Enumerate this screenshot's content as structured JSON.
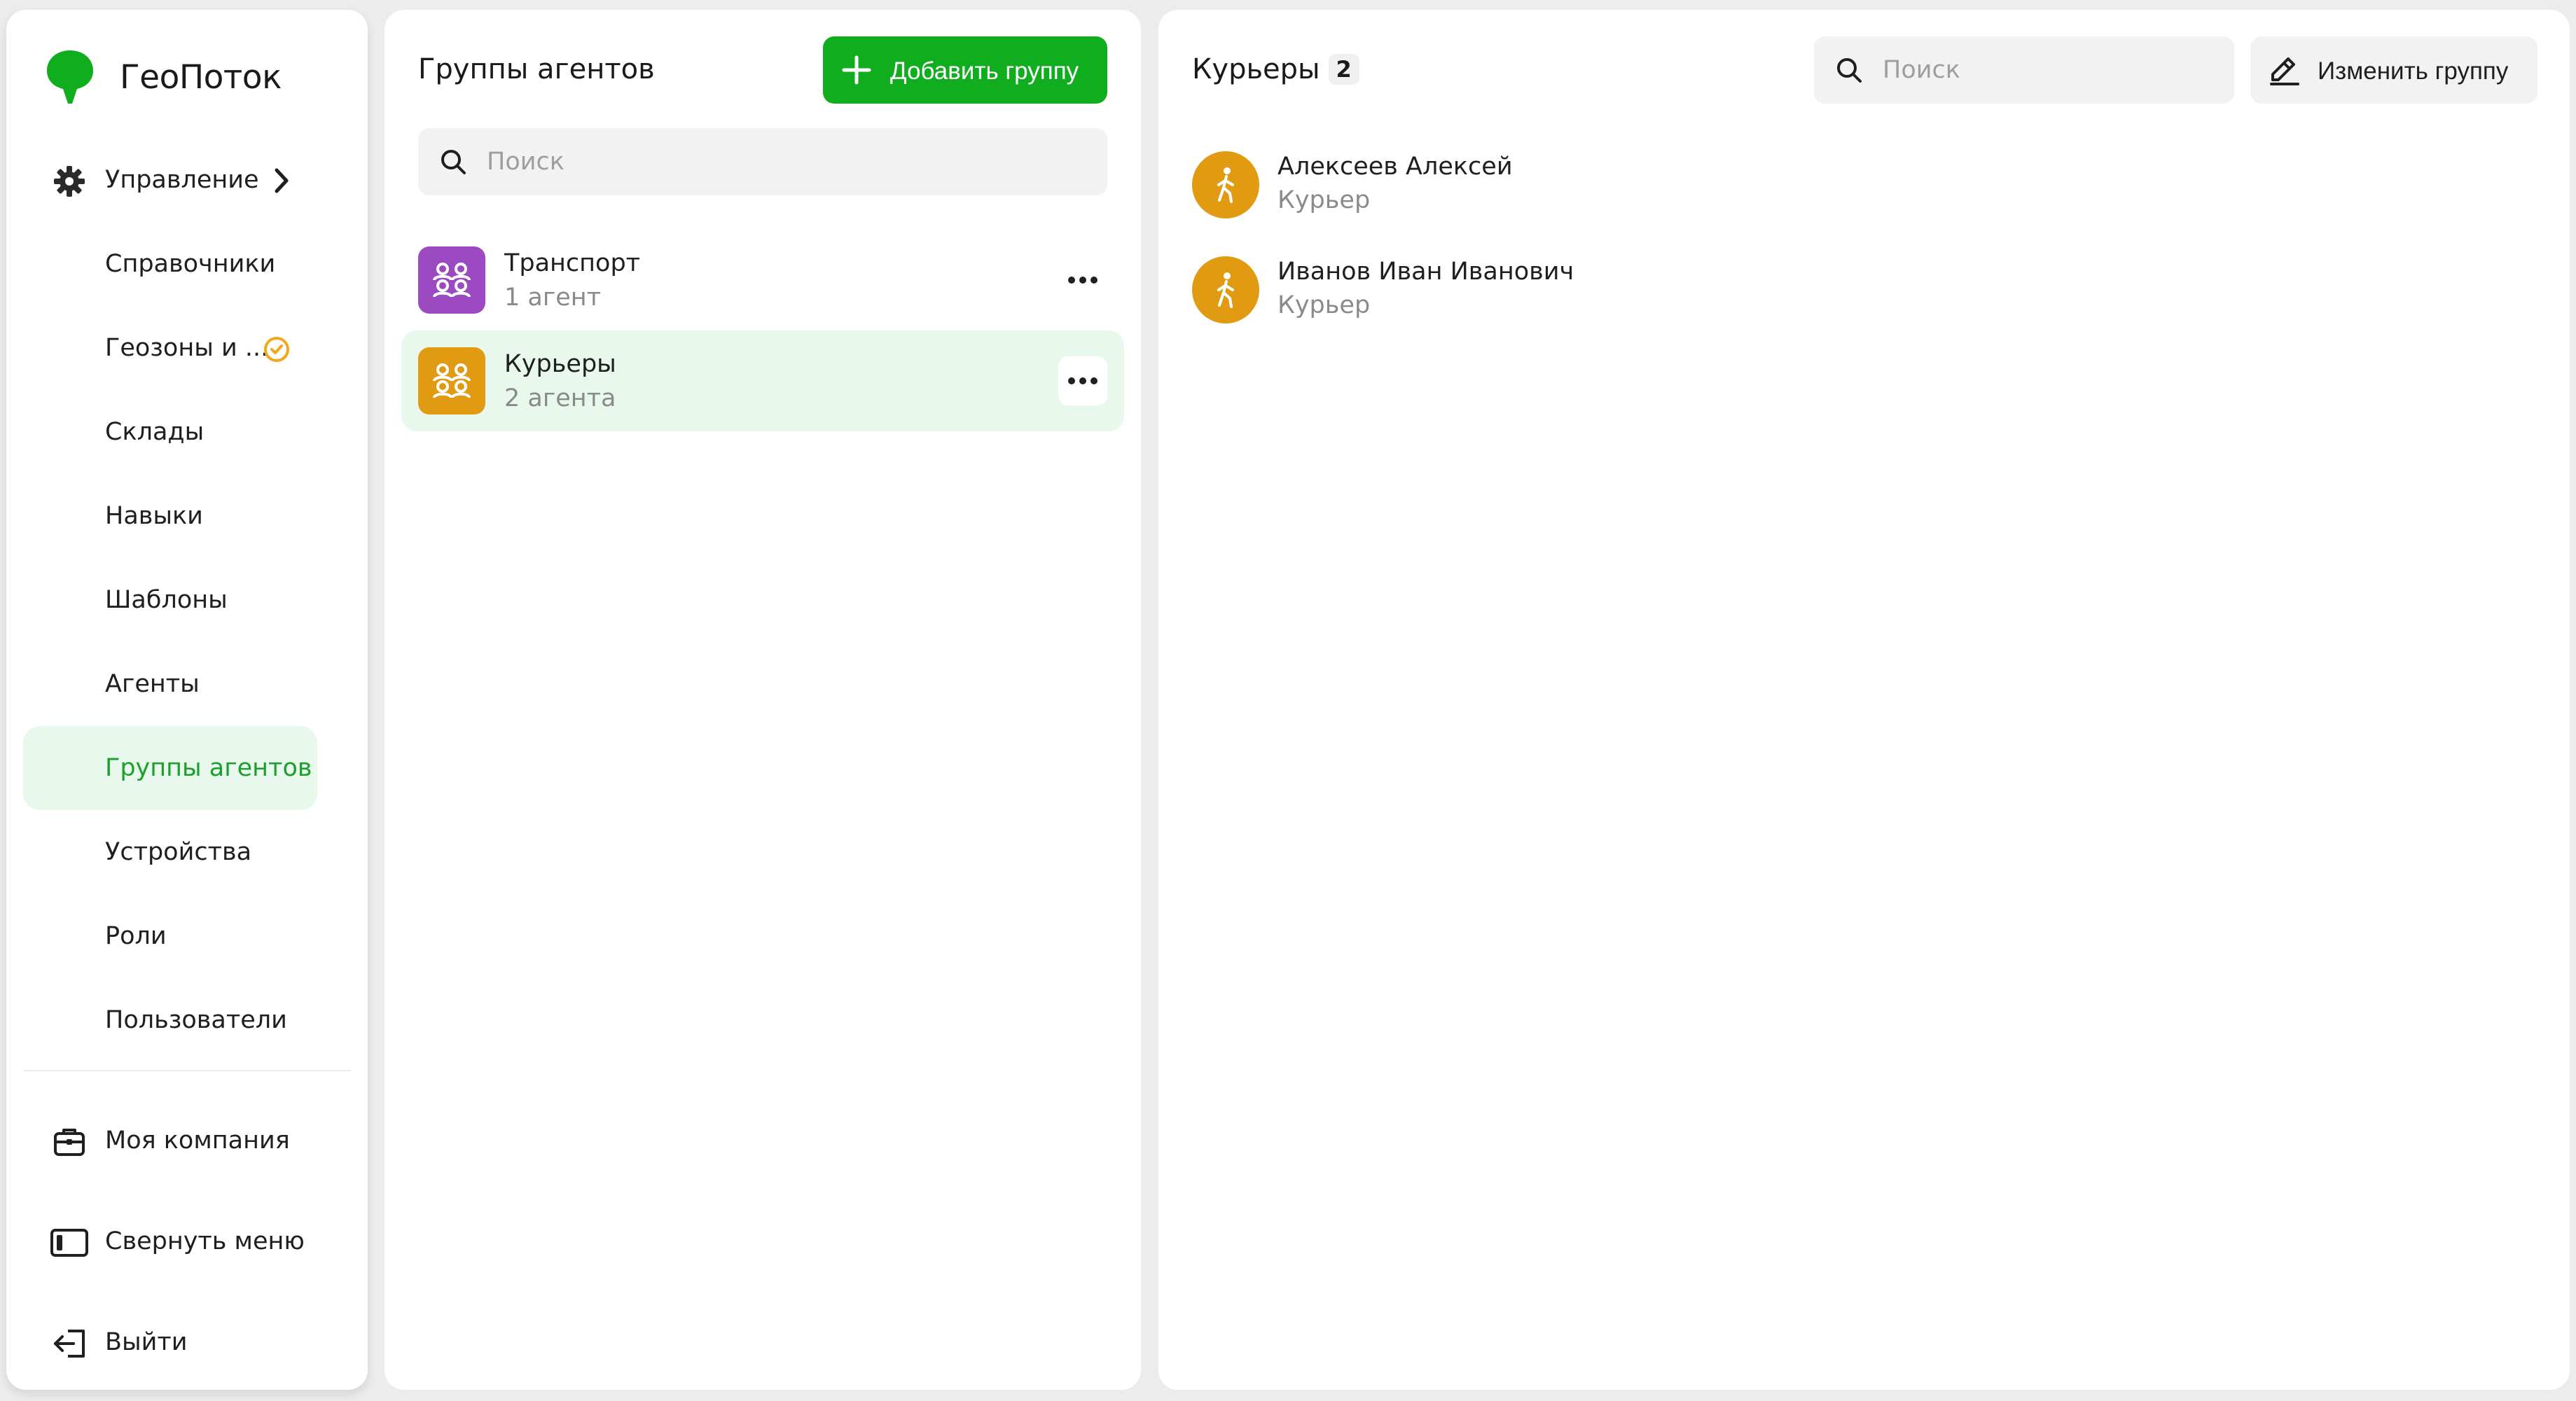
{
  "colors": {
    "brand_green": "#10ad1f",
    "active_bg": "#e8f8ec",
    "active_text": "#1c9f2b",
    "transport_group": "#9b4ac2",
    "couriers_group": "#e09b12",
    "badge_orange": "#f3a81b"
  },
  "app": {
    "name": "ГеоПоток"
  },
  "sidebar": {
    "management": {
      "label": "Управление",
      "icon": "gear-icon"
    },
    "items": [
      {
        "label": "Справочники"
      },
      {
        "label": "Геозоны и ...",
        "badge_icon": "clock-check-icon"
      },
      {
        "label": "Склады"
      },
      {
        "label": "Навыки"
      },
      {
        "label": "Шаблоны"
      },
      {
        "label": "Агенты"
      },
      {
        "label": "Группы агентов",
        "active": true
      },
      {
        "label": "Устройства"
      },
      {
        "label": "Роли"
      },
      {
        "label": "Пользователи"
      }
    ],
    "footer": [
      {
        "label": "Моя компания",
        "icon": "briefcase-icon"
      },
      {
        "label": "Свернуть меню",
        "icon": "collapse-sidebar-icon"
      },
      {
        "label": "Выйти",
        "icon": "logout-icon"
      }
    ]
  },
  "groups": {
    "title": "Группы агентов",
    "add_label": "Добавить группу",
    "search_placeholder": "Поиск",
    "list": [
      {
        "name": "Транспорт",
        "count_label": "1 агент",
        "color": "#9b4ac2",
        "active": false
      },
      {
        "name": "Курьеры",
        "count_label": "2 агента",
        "color": "#e09b12",
        "active": true
      }
    ]
  },
  "detail": {
    "title": "Курьеры",
    "count": "2",
    "search_placeholder": "Поиск",
    "edit_label": "Изменить группу",
    "agents": [
      {
        "name": "Алексеев Алексей",
        "role": "Курьер"
      },
      {
        "name": "Иванов Иван Иванович",
        "role": "Курьер"
      }
    ]
  }
}
